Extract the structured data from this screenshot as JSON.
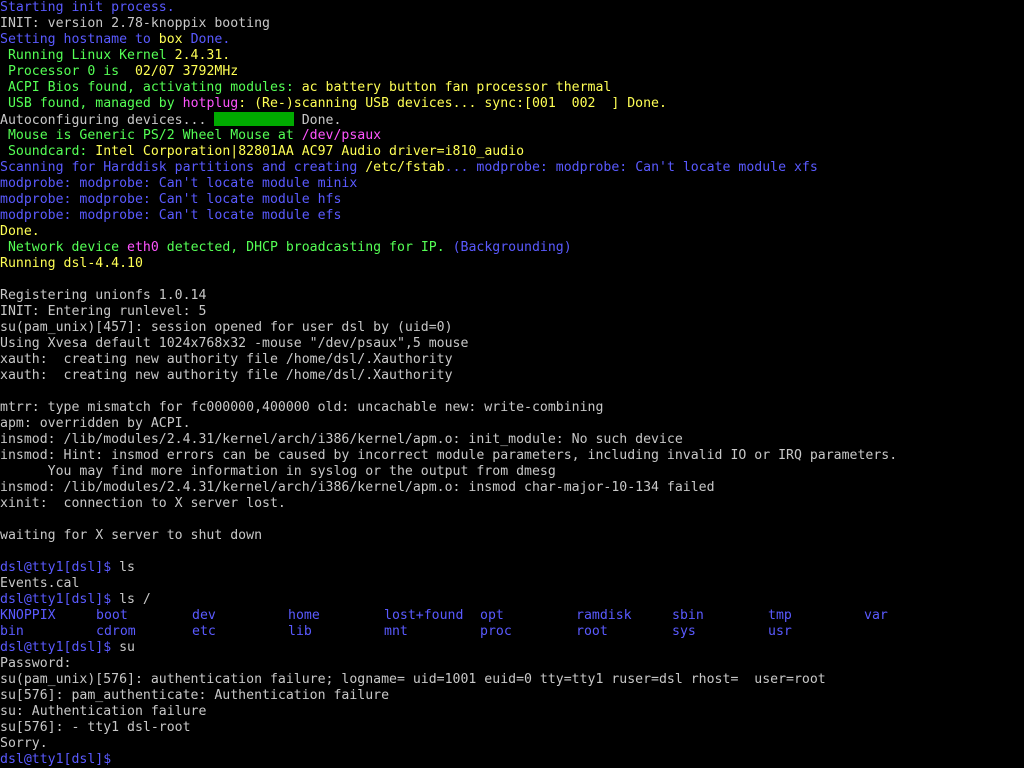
{
  "colors": {
    "default": "#c8c8c8",
    "blue": "#5a5aff",
    "yellow": "#ffff55",
    "green": "#55ff55",
    "magenta": "#ff55ff",
    "bar": "#00aa00"
  },
  "terminal": {
    "lines": [
      [
        {
          "t": "Starting init process.",
          "c": "blue"
        }
      ],
      [
        {
          "t": "INIT: version 2.78-knoppix booting",
          "c": "default"
        }
      ],
      [
        {
          "t": "Setting hostname to ",
          "c": "blue"
        },
        {
          "t": "box",
          "c": "yellow"
        },
        {
          "t": " Done.",
          "c": "blue"
        }
      ],
      [
        {
          "t": " Running Linux Kernel ",
          "c": "green"
        },
        {
          "t": "2.4.31.",
          "c": "yellow"
        }
      ],
      [
        {
          "t": " Processor 0 is  ",
          "c": "green"
        },
        {
          "t": "02/07 3792MHz",
          "c": "yellow"
        }
      ],
      [
        {
          "t": " ACPI Bios found, activating modules: ",
          "c": "green"
        },
        {
          "t": "ac battery button fan processor thermal",
          "c": "yellow"
        }
      ],
      [
        {
          "t": " USB found, managed by ",
          "c": "green"
        },
        {
          "t": "hotplug",
          "c": "magenta"
        },
        {
          "t": ": (Re-)scanning USB devices... sync:[001  002  ] Done.",
          "c": "yellow"
        }
      ],
      [
        {
          "t": "Autoconfiguring devices... ",
          "c": "default"
        },
        {
          "bar": "10ch"
        },
        {
          "t": " Done.",
          "c": "default"
        }
      ],
      [
        {
          "t": " Mouse is Generic PS/2 Wheel Mouse at ",
          "c": "green"
        },
        {
          "t": "/dev/psaux",
          "c": "magenta"
        }
      ],
      [
        {
          "t": " Soundcard: ",
          "c": "green"
        },
        {
          "t": "Intel Corporation|82801AA AC97 Audio driver=i810_audio",
          "c": "yellow"
        }
      ],
      [
        {
          "t": "Scanning for Harddisk partitions and creating ",
          "c": "blue"
        },
        {
          "t": "/etc/fstab",
          "c": "yellow"
        },
        {
          "t": "... modprobe: modprobe: Can't locate module xfs",
          "c": "blue"
        }
      ],
      [
        {
          "t": "modprobe: modprobe: Can't locate module minix",
          "c": "blue"
        }
      ],
      [
        {
          "t": "modprobe: modprobe: Can't locate module hfs",
          "c": "blue"
        }
      ],
      [
        {
          "t": "modprobe: modprobe: Can't locate module efs",
          "c": "blue"
        }
      ],
      [
        {
          "t": "Done.",
          "c": "yellow"
        }
      ],
      [
        {
          "t": " Network device ",
          "c": "green"
        },
        {
          "t": "eth0",
          "c": "magenta"
        },
        {
          "t": " detected, DHCP broadcasting for IP. ",
          "c": "green"
        },
        {
          "t": "(Backgrounding)",
          "c": "blue"
        }
      ],
      [
        {
          "t": "Running dsl-4.4.10",
          "c": "yellow"
        }
      ],
      [],
      [
        {
          "t": "Registering unionfs 1.0.14",
          "c": "default"
        }
      ],
      [
        {
          "t": "INIT: Entering runlevel: 5",
          "c": "default"
        }
      ],
      [
        {
          "t": "su(pam_unix)[457]: session opened for user dsl by (uid=0)",
          "c": "default"
        }
      ],
      [
        {
          "t": "Using Xvesa default 1024x768x32 -mouse \"/dev/psaux\",5 mouse",
          "c": "default"
        }
      ],
      [
        {
          "t": "xauth:  creating new authority file /home/dsl/.Xauthority",
          "c": "default"
        }
      ],
      [
        {
          "t": "xauth:  creating new authority file /home/dsl/.Xauthority",
          "c": "default"
        }
      ],
      [],
      [
        {
          "t": "mtrr: type mismatch for fc000000,400000 old: uncachable new: write-combining",
          "c": "default"
        }
      ],
      [
        {
          "t": "apm: overridden by ACPI.",
          "c": "default"
        }
      ],
      [
        {
          "t": "insmod: /lib/modules/2.4.31/kernel/arch/i386/kernel/apm.o: init_module: No such device",
          "c": "default"
        }
      ],
      [
        {
          "t": "insmod: Hint: insmod errors can be caused by incorrect module parameters, including invalid IO or IRQ parameters.",
          "c": "default"
        }
      ],
      [
        {
          "t": "      You may find more information in syslog or the output from dmesg",
          "c": "default"
        }
      ],
      [
        {
          "t": "insmod: /lib/modules/2.4.31/kernel/arch/i386/kernel/apm.o: insmod char-major-10-134 failed",
          "c": "default"
        }
      ],
      [
        {
          "t": "xinit:  connection to X server lost.",
          "c": "default"
        }
      ],
      [],
      [
        {
          "t": "waiting for X server to shut down",
          "c": "default"
        }
      ],
      [],
      [
        {
          "t": "dsl@tty1[dsl]$",
          "c": "blue"
        },
        {
          "t": " ls",
          "c": "default"
        }
      ],
      [
        {
          "t": "Events.cal",
          "c": "default"
        }
      ],
      [
        {
          "t": "dsl@tty1[dsl]$",
          "c": "blue"
        },
        {
          "t": " ls /",
          "c": "default"
        }
      ],
      {
        "ls": [
          {
            "t": "KNOPPIX",
            "c": "blue"
          },
          {
            "t": "boot",
            "c": "blue"
          },
          {
            "t": "dev",
            "c": "blue"
          },
          {
            "t": "home",
            "c": "blue"
          },
          {
            "t": "lost+found",
            "c": "blue"
          },
          {
            "t": "opt",
            "c": "blue"
          },
          {
            "t": "ramdisk",
            "c": "blue"
          },
          {
            "t": "sbin",
            "c": "blue"
          },
          {
            "t": "tmp",
            "c": "blue"
          },
          {
            "t": "var",
            "c": "blue"
          }
        ]
      },
      {
        "ls": [
          {
            "t": "bin",
            "c": "blue"
          },
          {
            "t": "cdrom",
            "c": "blue"
          },
          {
            "t": "etc",
            "c": "blue"
          },
          {
            "t": "lib",
            "c": "blue"
          },
          {
            "t": "mnt",
            "c": "blue"
          },
          {
            "t": "proc",
            "c": "blue"
          },
          {
            "t": "root",
            "c": "blue"
          },
          {
            "t": "sys",
            "c": "blue"
          },
          {
            "t": "usr",
            "c": "blue"
          }
        ]
      },
      [
        {
          "t": "dsl@tty1[dsl]$",
          "c": "blue"
        },
        {
          "t": " su",
          "c": "default"
        }
      ],
      [
        {
          "t": "Password:",
          "c": "default"
        }
      ],
      [
        {
          "t": "su(pam_unix)[576]: authentication failure; logname= uid=1001 euid=0 tty=tty1 ruser=dsl rhost=  user=root",
          "c": "default"
        }
      ],
      [
        {
          "t": "su[576]: pam_authenticate: Authentication failure",
          "c": "default"
        }
      ],
      [
        {
          "t": "su: Authentication failure",
          "c": "default"
        }
      ],
      [
        {
          "t": "su[576]: - tty1 dsl-root",
          "c": "default"
        }
      ],
      [
        {
          "t": "Sorry.",
          "c": "default"
        }
      ],
      [
        {
          "t": "dsl@tty1[dsl]$",
          "c": "blue"
        }
      ]
    ]
  }
}
